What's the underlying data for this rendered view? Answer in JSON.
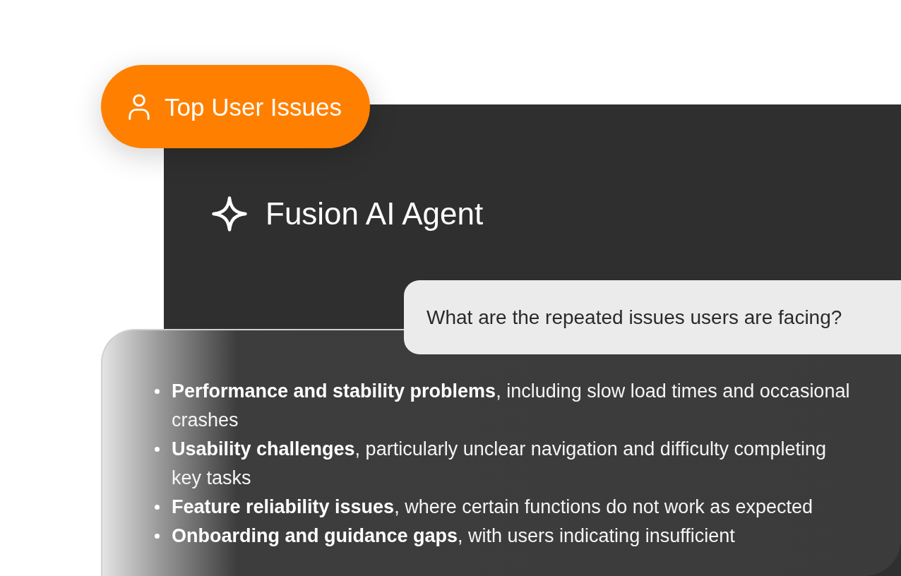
{
  "tag": {
    "label": "Top User Issues"
  },
  "agent": {
    "title": "Fusion AI Agent"
  },
  "question": "What are the repeated issues users are facing?",
  "answer": {
    "items": [
      "**Performance and stability problems**, including slow load times and occasional crashes",
      "**Usability challenges**, particularly unclear navigation and difficulty completing key tasks",
      "**Feature reliability issues**, where certain functions do not work as expected",
      "**Onboarding and guidance gaps**, with users indicating insufficient"
    ]
  }
}
